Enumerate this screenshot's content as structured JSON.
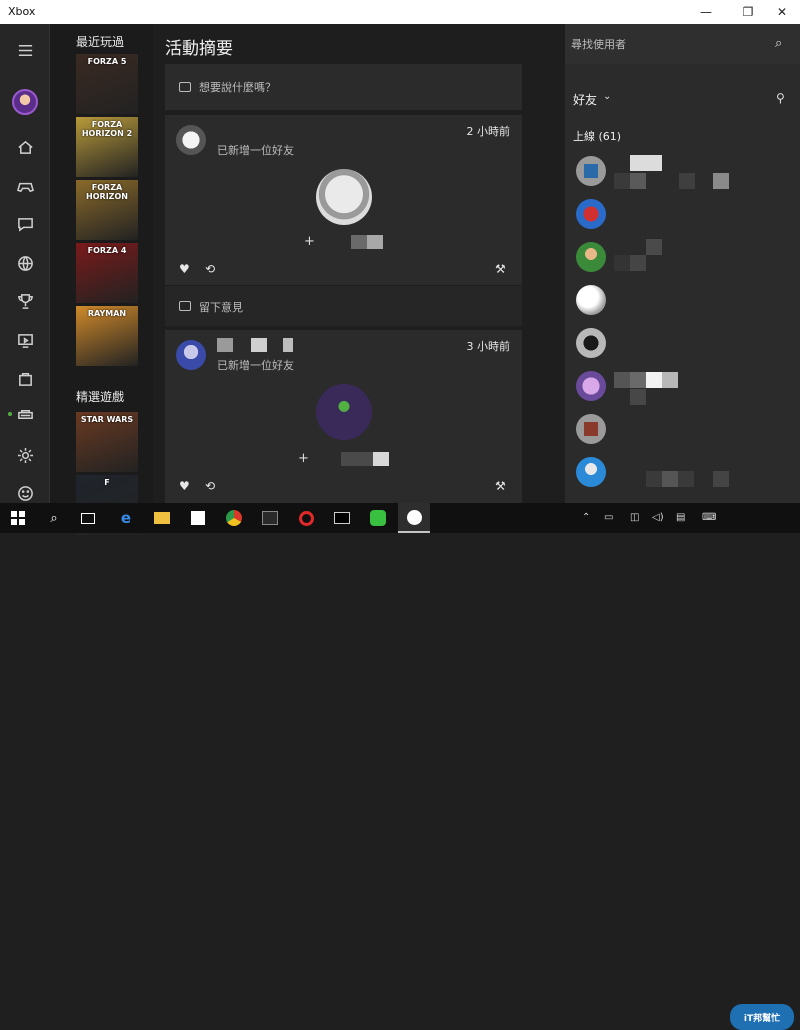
{
  "window": {
    "title": "Xbox",
    "minimize": "—",
    "maximize": "❐",
    "close": "✕"
  },
  "nav": {
    "icons": [
      "hamburger-icon",
      "avatar",
      "home-icon",
      "controller-icon",
      "message-icon",
      "globe-icon",
      "trophy-icon",
      "dvr-icon",
      "store-icon",
      "console-icon",
      "settings-icon",
      "smiley-icon"
    ]
  },
  "games": {
    "recent_label": "最近玩過",
    "featured_label": "精選遊戲",
    "recent_tiles": [
      {
        "label": "FORZA 5",
        "bg": "#3a2a22"
      },
      {
        "label": "FORZA HORIZON 2",
        "bg": "#b89a3a"
      },
      {
        "label": "FORZA HORIZON",
        "bg": "#8a6a2a"
      },
      {
        "label": "FORZA 4",
        "bg": "#7a1a1a"
      },
      {
        "label": "RAYMAN",
        "bg": "#d08a2a"
      }
    ],
    "featured_tiles": [
      {
        "label": "STAR WARS",
        "bg": "#6a3a22"
      },
      {
        "label": "F",
        "bg": "#20252c"
      }
    ]
  },
  "feed": {
    "title": "活動摘要",
    "compose_placeholder": "想要說什麼嗎？",
    "posts": [
      {
        "time": "2 小時前",
        "text": "已新增一位好友",
        "plus": "+",
        "comment_placeholder": "留下意見"
      },
      {
        "time": "3 小時前",
        "text": "已新增一位好友",
        "plus": "+"
      }
    ]
  },
  "friends": {
    "search_placeholder": "尋找使用者",
    "friends_label": "好友",
    "online_label": "上線 (61)"
  },
  "taskbar": {
    "tray_text": "",
    "watermark": "iT邦幫忙"
  },
  "colors": {
    "accent_purple": "#7a2fa8",
    "online_green": "#52b043"
  }
}
